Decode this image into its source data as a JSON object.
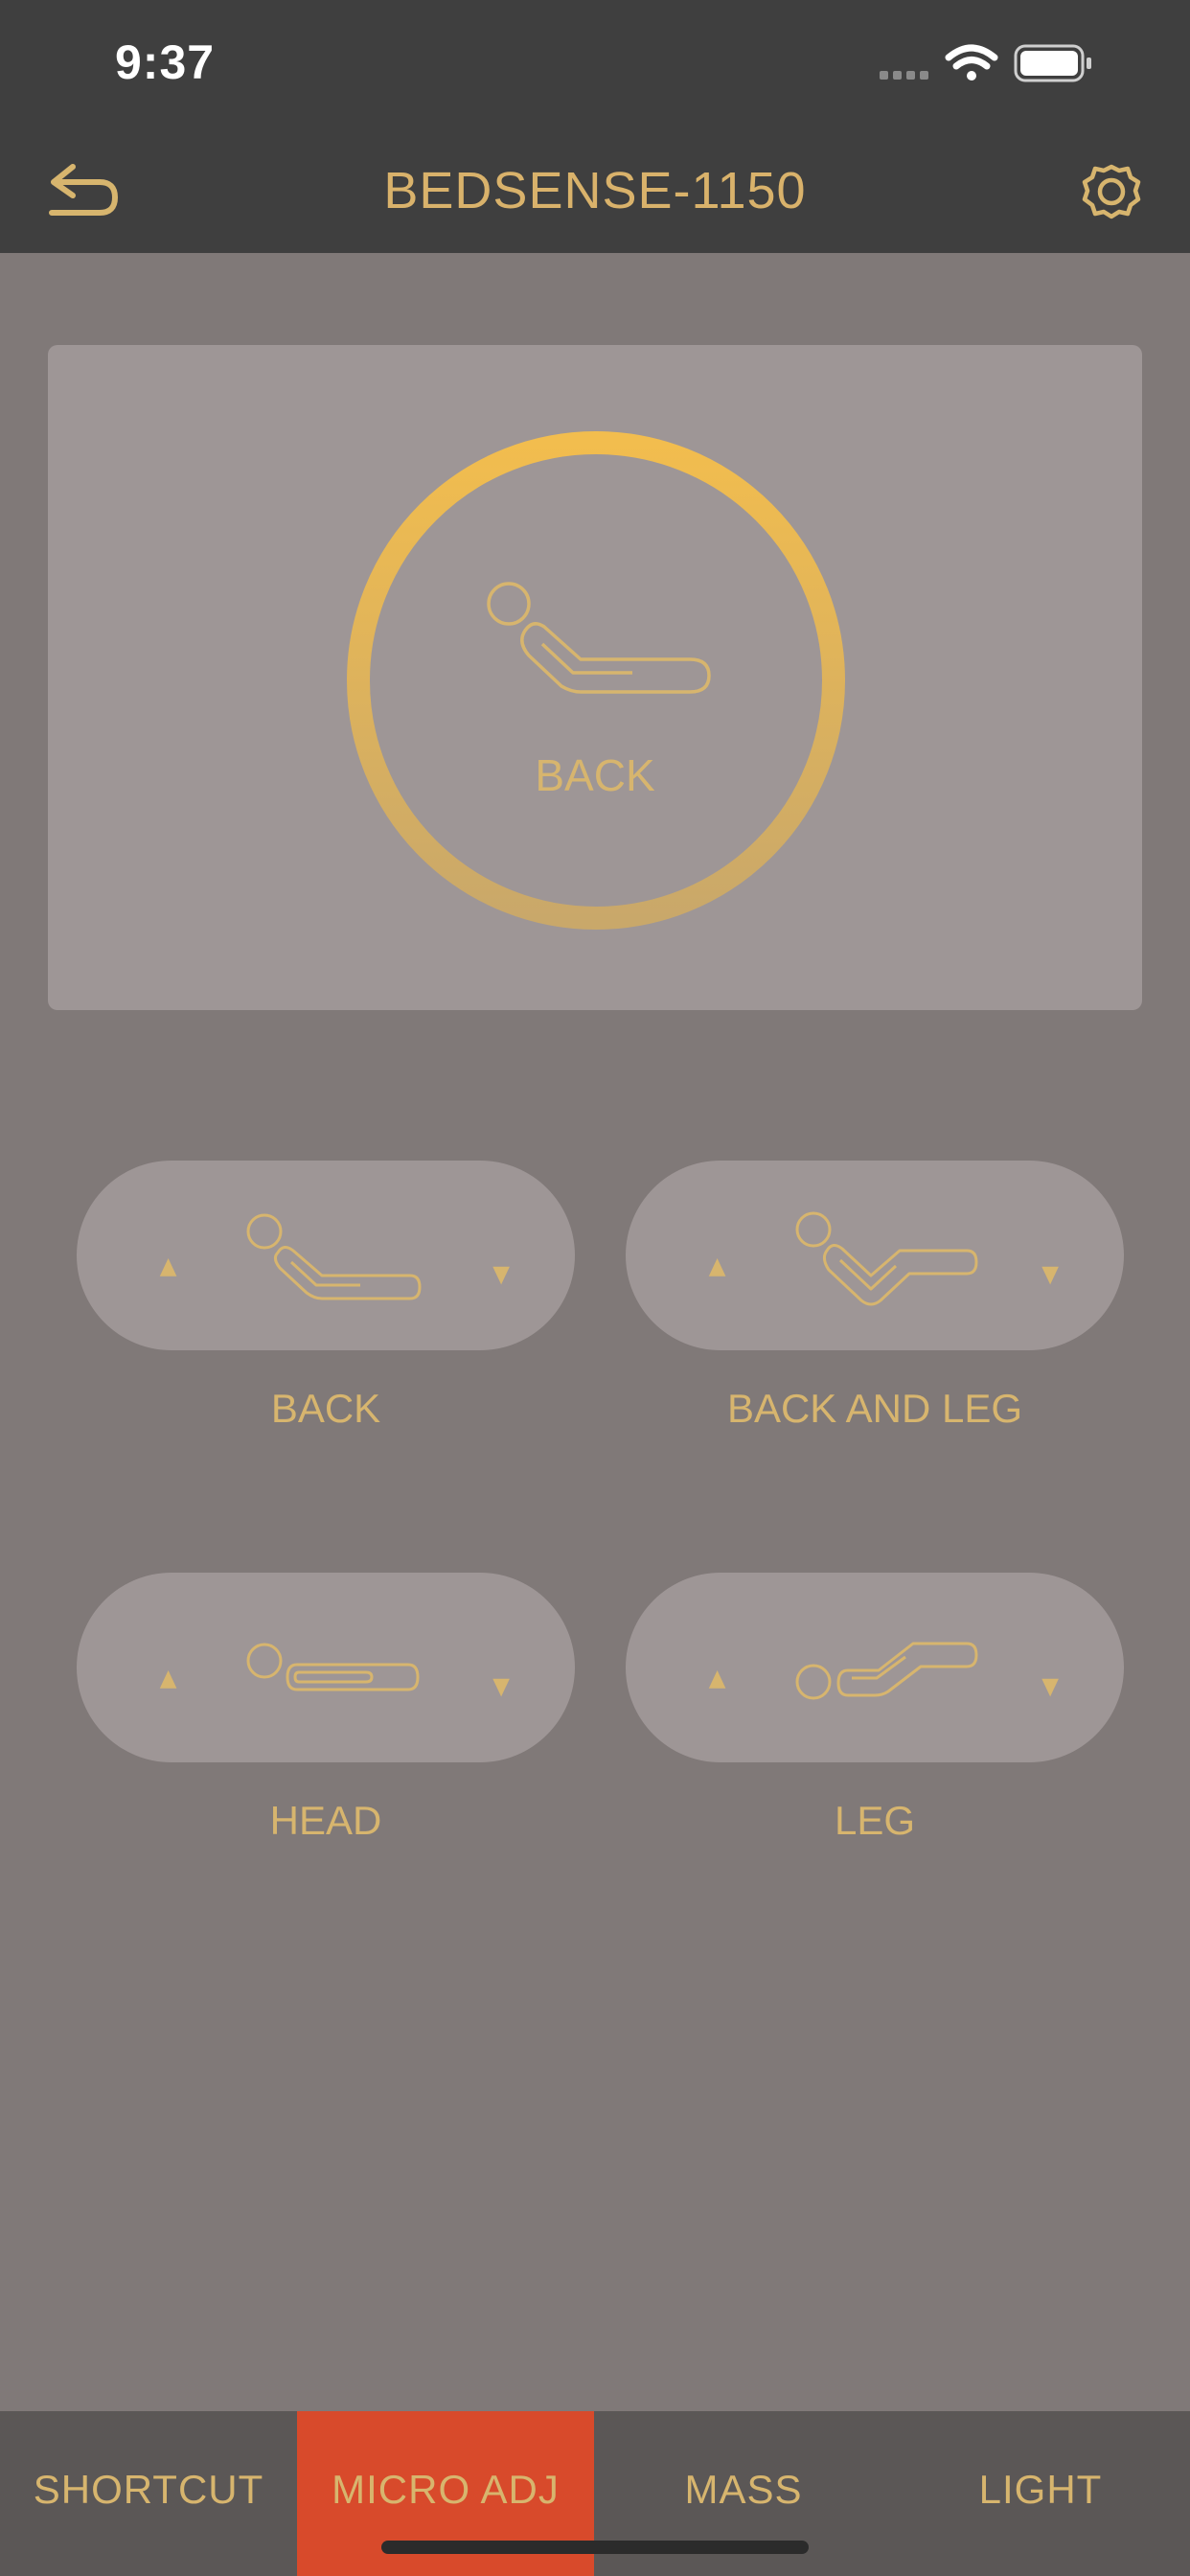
{
  "status_bar": {
    "time": "9:37"
  },
  "header": {
    "title": "BEDSENSE-1150",
    "back_icon": "back-arrow-icon",
    "settings_icon": "gear-icon"
  },
  "preview": {
    "label": "BACK"
  },
  "controls": [
    {
      "label": "BACK",
      "icon": "bed-back-icon"
    },
    {
      "label": "BACK AND LEG",
      "icon": "bed-back-and-leg-icon"
    },
    {
      "label": "HEAD",
      "icon": "bed-head-icon"
    },
    {
      "label": "LEG",
      "icon": "bed-leg-icon"
    }
  ],
  "tabs": [
    {
      "label": "SHORTCUT",
      "active": false
    },
    {
      "label": "MICRO ADJ",
      "active": true
    },
    {
      "label": "MASS",
      "active": false
    },
    {
      "label": "LIGHT",
      "active": false
    }
  ],
  "colors": {
    "accent_gold": "#d7b56e",
    "ring_gold": "#f0bd4f",
    "active_tab": "#d84a2b",
    "background": "#807978",
    "card": "#9e9696",
    "bar": "#3f3f3f"
  }
}
